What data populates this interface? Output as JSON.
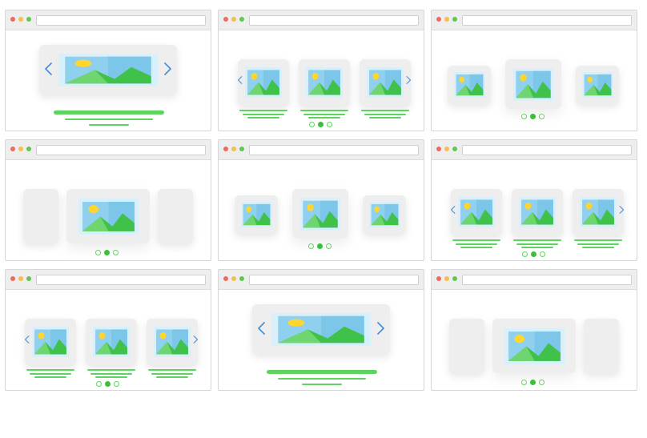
{
  "colors": {
    "accent_green": "#5fd35f",
    "arrow_blue": "#4a90d9",
    "card_gray": "#eeeeee",
    "sky_blue": "#8fd0ee",
    "sun_yellow": "#ffd52e",
    "mountain_green": "#3fc14a"
  },
  "icons": {
    "image": "image-placeholder-icon",
    "prev": "chevron-left-icon",
    "next": "chevron-right-icon",
    "window_controls": [
      "close-dot",
      "minimize-dot",
      "maximize-dot"
    ]
  },
  "panels": [
    {
      "variant": "single-card-with-arrows",
      "page_dots": 0,
      "active_dot": null
    },
    {
      "variant": "three-cards-with-arrows",
      "page_dots": 3,
      "active_dot": 2
    },
    {
      "variant": "center-focus-three",
      "page_dots": 3,
      "active_dot": 2
    },
    {
      "variant": "center-focus-gray-sides",
      "page_dots": 3,
      "active_dot": 2
    },
    {
      "variant": "center-focus-three",
      "page_dots": 3,
      "active_dot": 2
    },
    {
      "variant": "three-cards-with-arrows",
      "page_dots": 3,
      "active_dot": 2
    },
    {
      "variant": "three-cards-with-arrows",
      "page_dots": 3,
      "active_dot": 2
    },
    {
      "variant": "single-card-with-arrows",
      "page_dots": 0,
      "active_dot": null
    },
    {
      "variant": "center-focus-gray-sides",
      "page_dots": 3,
      "active_dot": 2
    }
  ]
}
